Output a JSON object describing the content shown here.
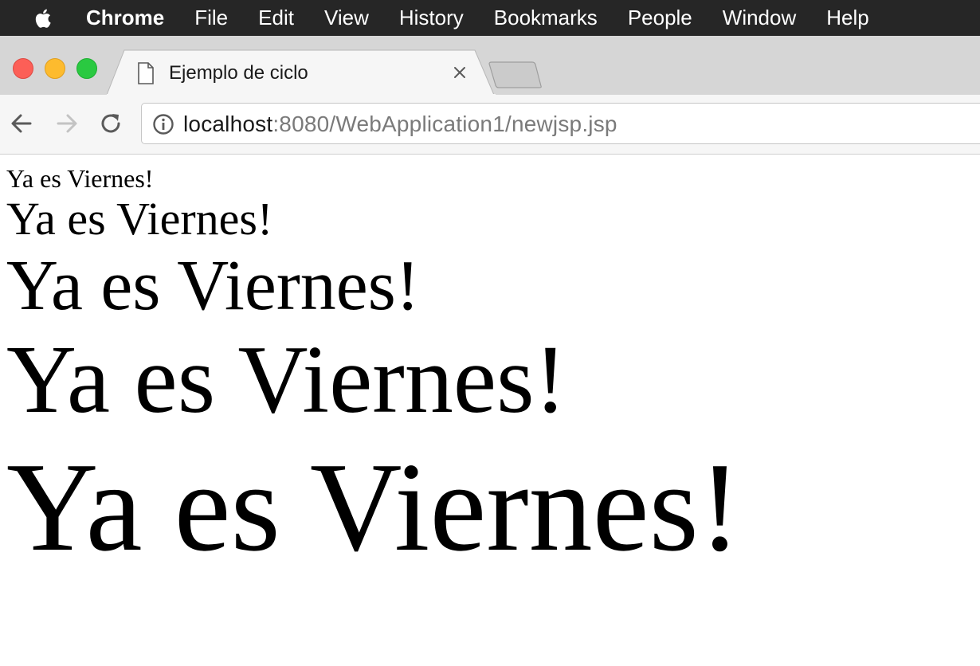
{
  "menubar": {
    "app_name": "Chrome",
    "items": [
      "File",
      "Edit",
      "View",
      "History",
      "Bookmarks",
      "People",
      "Window",
      "Help"
    ]
  },
  "tab": {
    "title": "Ejemplo de ciclo"
  },
  "address_bar": {
    "host": "localhost",
    "rest": ":8080/WebApplication1/newjsp.jsp"
  },
  "page": {
    "lines": [
      "Ya es Viernes!",
      "Ya es Viernes!",
      "Ya es Viernes!",
      "Ya es Viernes!",
      "Ya es Viernes!"
    ]
  },
  "colors": {
    "menubar_bg": "#262626",
    "tabstrip_bg": "#d6d6d6",
    "toolbar_bg": "#f6f6f6",
    "close_red": "#fc5f57",
    "minimize_yellow": "#fdbb2e",
    "zoom_green": "#2ac941"
  },
  "icons": {
    "apple": "apple-logo-icon",
    "tab_page": "document-icon",
    "tab_close": "close-icon",
    "back": "back-arrow-icon",
    "forward": "forward-arrow-icon",
    "reload": "reload-icon",
    "site_info": "info-icon"
  }
}
